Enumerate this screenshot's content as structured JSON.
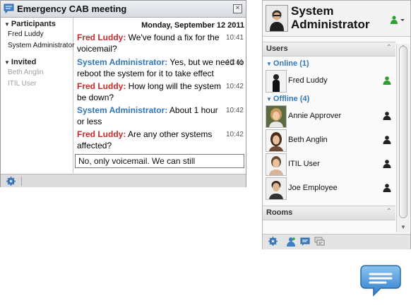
{
  "chat": {
    "title": "Emergency CAB meeting",
    "close_glyph": "×",
    "date": "Monday, September 12 2011",
    "participants_label": "Participants",
    "participants": [
      "Fred Luddy",
      "System Administrator"
    ],
    "invited_label": "Invited",
    "invited": [
      "Beth Anglin",
      "ITIL User"
    ],
    "messages": [
      {
        "sender": "Fred Luddy:",
        "text": "We've found a fix for the voicemail?",
        "time": "10:41"
      },
      {
        "sender": "System Administrator:",
        "text": "Yes, but we need to reboot the system for it to take effect",
        "time": "10:41"
      },
      {
        "sender": "Fred Luddy:",
        "text": "How long will the system be down?",
        "time": "10:42"
      },
      {
        "sender": "System Administrator:",
        "text": "About 1 hour or less",
        "time": "10:42"
      },
      {
        "sender": "Fred Luddy:",
        "text": "Are any other systems affected?",
        "time": "10:42"
      }
    ],
    "compose_value": "No, only voicemail. We can still",
    "footer_icons": [
      "gear-icon"
    ]
  },
  "panel": {
    "me_name": "System Administrator",
    "me_status_icon": "user-status-green-icon",
    "users_label": "Users",
    "online_label": "Online (1)",
    "online": [
      {
        "name": "Fred Luddy",
        "status": "online-green-icon"
      }
    ],
    "offline_label": "Offline (4)",
    "offline": [
      {
        "name": "Annie Approver",
        "status": "offline-black-icon"
      },
      {
        "name": "Beth Anglin",
        "status": "offline-black-icon"
      },
      {
        "name": "ITIL User",
        "status": "offline-black-icon"
      },
      {
        "name": "Joe Employee",
        "status": "offline-black-icon"
      }
    ],
    "rooms_label": "Rooms",
    "footer_icons": [
      "gear-icon",
      "add-user-icon",
      "new-chat-icon",
      "chat-history-icon"
    ]
  },
  "colors": {
    "sender_fred": "#c52b2b",
    "sender_admin": "#2f77b8",
    "online_green": "#2ea033",
    "group_blue": "#2f77b8",
    "launcher_blue": "#3c8fd6"
  }
}
